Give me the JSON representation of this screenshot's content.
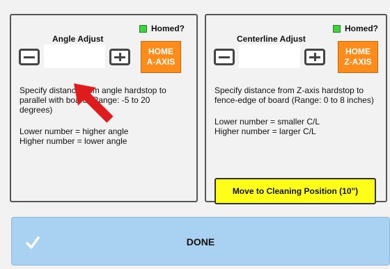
{
  "left_panel": {
    "title": "Angle Adjust",
    "homed_label": "Homed?",
    "stepper_value": "",
    "home_button_line1": "HOME",
    "home_button_line2": "A-AXIS",
    "desc_line1": "Specify distance from angle hardstop to",
    "desc_line2": "parallel with board (Range: -5 to 20",
    "desc_line3": "degrees)",
    "note_line1": "Lower number = higher angle",
    "note_line2": "Higher number = lower angle"
  },
  "right_panel": {
    "title": "Centerline Adjust",
    "homed_label": "Homed?",
    "stepper_value": "",
    "home_button_line1": "HOME",
    "home_button_line2": "Z-AXIS",
    "desc_line1": "Specify distance from Z-axis hardstop to",
    "desc_line2": "fence-edge of board (Range: 0 to 8 inches)",
    "note_line1": "Lower number = smaller C/L",
    "note_line2": "Higher number = larger C/L",
    "move_button_label": "Move to Cleaning Position (10\")"
  },
  "done_button": {
    "label": "DONE"
  },
  "colors": {
    "home_button": "#ff8c1a",
    "homed_led": "#3fd13f",
    "move_button": "#ffff1a",
    "done_button": "#a8d1f2",
    "annotation_arrow": "#e01b1b"
  }
}
